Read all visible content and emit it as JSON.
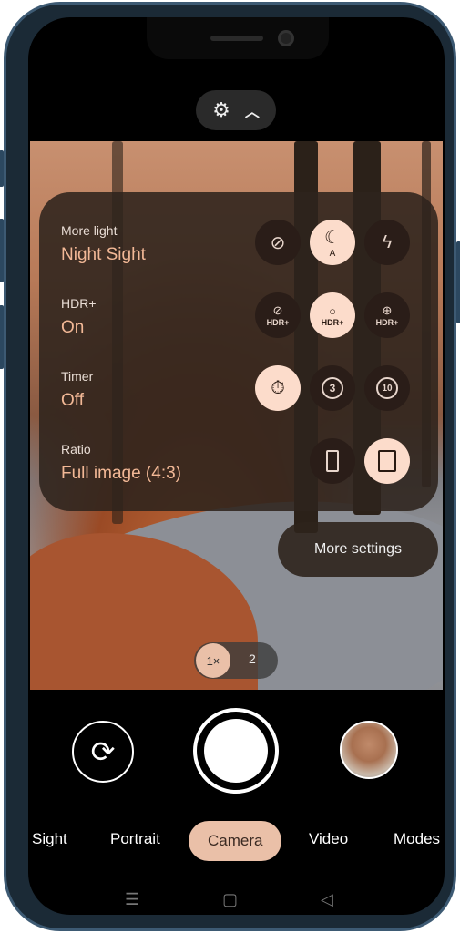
{
  "top_controls": {
    "settings_icon": "gear-icon",
    "collapse_icon": "chevron-up-icon"
  },
  "settings": [
    {
      "label": "More light",
      "value": "Night Sight",
      "options": [
        {
          "icon": "flash-off-icon",
          "selected": false
        },
        {
          "icon": "night-sight-auto-icon",
          "selected": true
        },
        {
          "icon": "flash-on-icon",
          "selected": false
        }
      ]
    },
    {
      "label": "HDR+",
      "value": "On",
      "options": [
        {
          "icon": "hdr-off-icon",
          "text": "HDR+",
          "selected": false
        },
        {
          "icon": "hdr-on-icon",
          "text": "HDR+",
          "selected": true
        },
        {
          "icon": "hdr-enhanced-icon",
          "text": "HDR+",
          "selected": false
        }
      ]
    },
    {
      "label": "Timer",
      "value": "Off",
      "options": [
        {
          "icon": "timer-off-icon",
          "selected": true
        },
        {
          "icon": "timer-3-icon",
          "selected": false
        },
        {
          "icon": "timer-10-icon",
          "selected": false
        }
      ]
    },
    {
      "label": "Ratio",
      "value": "Full image (4:3)",
      "options": [
        {
          "icon": "ratio-tall-icon",
          "selected": false
        },
        {
          "icon": "ratio-4-3-icon",
          "selected": true
        }
      ]
    }
  ],
  "more_settings": "More settings",
  "zoom": {
    "options": [
      "1×",
      "2"
    ],
    "selected": "1×"
  },
  "modes": [
    "Sight",
    "Portrait",
    "Camera",
    "Video",
    "Modes"
  ],
  "selected_mode": "Camera",
  "colors": {
    "accent": "#eac0a8",
    "value_text": "#f2b896",
    "panel": "#2d231c"
  }
}
